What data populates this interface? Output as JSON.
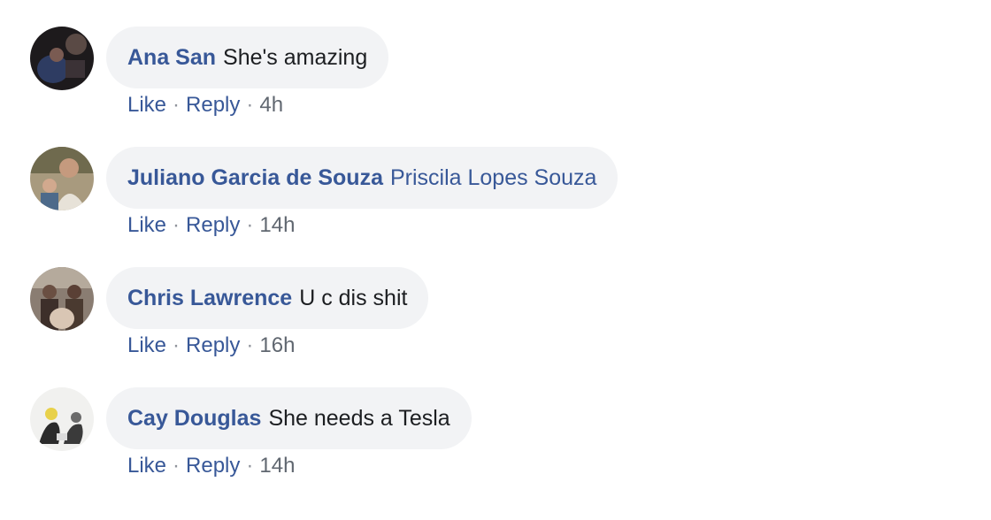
{
  "comments": [
    {
      "author": "Ana San",
      "text": "She's amazing",
      "text_is_tag": false,
      "like_label": "Like",
      "reply_label": "Reply",
      "separator": "·",
      "time": "4h",
      "avatar_icon": "profile-photo-icon"
    },
    {
      "author": "Juliano Garcia de Souza",
      "text": "Priscila Lopes Souza",
      "text_is_tag": true,
      "like_label": "Like",
      "reply_label": "Reply",
      "separator": "·",
      "time": "14h",
      "avatar_icon": "profile-photo-icon"
    },
    {
      "author": "Chris Lawrence",
      "text": "U c dis shit",
      "text_is_tag": false,
      "like_label": "Like",
      "reply_label": "Reply",
      "separator": "·",
      "time": "16h",
      "avatar_icon": "profile-photo-icon"
    },
    {
      "author": "Cay Douglas",
      "text": "She needs a Tesla",
      "text_is_tag": false,
      "like_label": "Like",
      "reply_label": "Reply",
      "separator": "·",
      "time": "14h",
      "avatar_icon": "profile-photo-icon"
    }
  ],
  "colors": {
    "link": "#385898",
    "bubble": "#f2f3f5",
    "text": "#1c1e21",
    "meta": "#606770"
  }
}
